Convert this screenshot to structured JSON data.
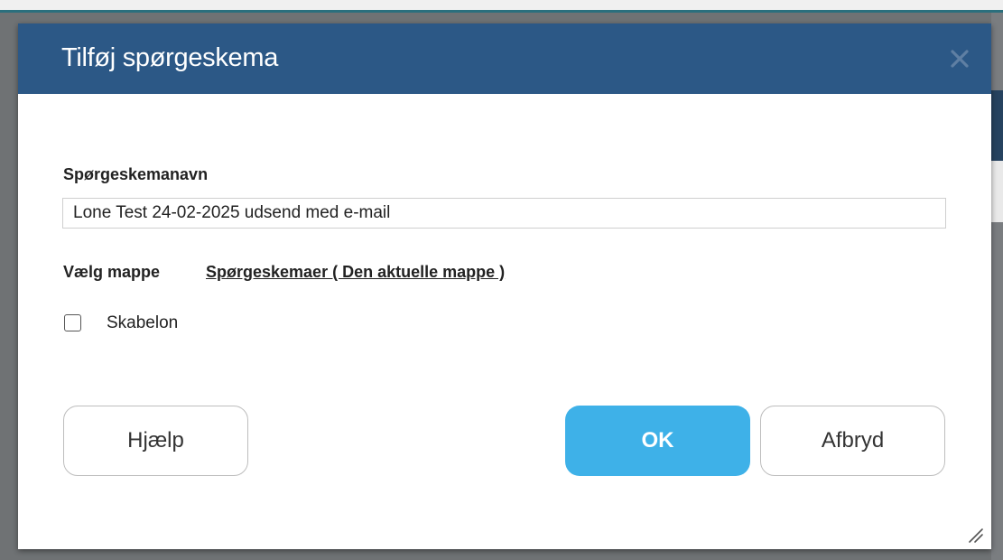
{
  "dialog": {
    "title": "Tilføj spørgeskema",
    "close_icon": "close-icon",
    "name_field": {
      "label": "Spørgeskemanavn",
      "value": "Lone Test 24-02-2025 udsend med e-mail"
    },
    "folder": {
      "label": "Vælg mappe",
      "link_text": "Spørgeskemaer ( Den aktuelle mappe )"
    },
    "template": {
      "label": "Skabelon",
      "checked": false
    },
    "buttons": {
      "help": "Hjælp",
      "ok": "OK",
      "cancel": "Afbryd"
    }
  },
  "colors": {
    "header": "#2c5886",
    "ok_button": "#3eb1e8",
    "overlay": "#6f7274"
  }
}
